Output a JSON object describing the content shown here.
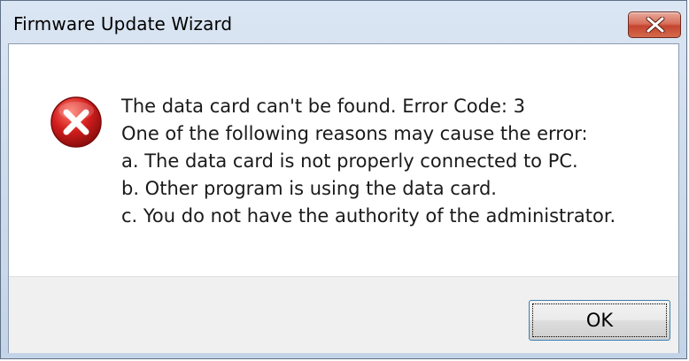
{
  "window": {
    "title": "Firmware Update Wizard",
    "close_icon": "close-icon"
  },
  "dialog": {
    "icon": "error-icon",
    "icon_color": "#d21e1e",
    "lines": [
      "The data card can't be found. Error Code: 3",
      "One of the following reasons may cause the error:",
      "a. The data card is not properly connected to PC.",
      "b. Other program is using the data card.",
      "c. You do not have the authority of the administrator."
    ]
  },
  "buttons": {
    "ok_label": "OK"
  }
}
